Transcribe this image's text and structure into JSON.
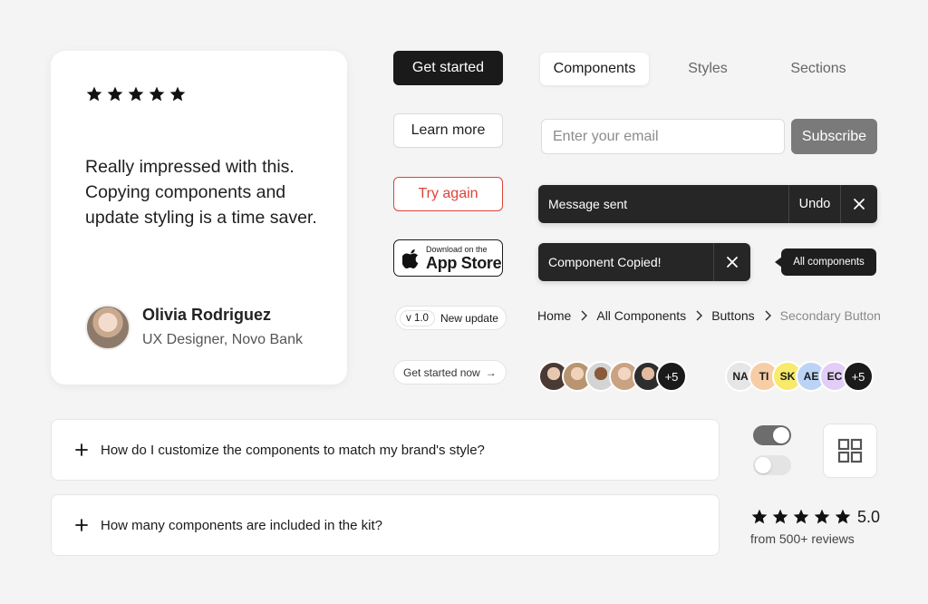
{
  "testimonial": {
    "stars": 5,
    "quote": "Really impressed with this. Copying components and update styling is a time saver.",
    "name": "Olivia Rodriguez",
    "role": "UX Designer, Novo Bank"
  },
  "buttons": {
    "get_started": "Get started",
    "learn_more": "Learn more",
    "try_again": "Try again",
    "app_store_small": "Download on the",
    "app_store_big": "App Store",
    "badge_version": "v 1.0",
    "badge_text": "New update",
    "get_started_now": "Get started now",
    "get_started_now_arrow": "→"
  },
  "tabs": [
    {
      "label": "Components",
      "active": true
    },
    {
      "label": "Styles",
      "active": false
    },
    {
      "label": "Sections",
      "active": false
    }
  ],
  "subscribe": {
    "placeholder": "Enter your email",
    "button": "Subscribe"
  },
  "toasts": {
    "message_sent": "Message sent",
    "undo": "Undo",
    "component_copied": "Component Copied!"
  },
  "tooltip": "All components",
  "breadcrumb": [
    "Home",
    "All Components",
    "Buttons",
    "Secondary Button"
  ],
  "avatar_group_photos": {
    "count_label": "+5"
  },
  "avatar_group_initials": {
    "items": [
      {
        "initials": "NA",
        "color": "#e6e6e6"
      },
      {
        "initials": "TI",
        "color": "#f7cda6"
      },
      {
        "initials": "SK",
        "color": "#f8ea6a"
      },
      {
        "initials": "AE",
        "color": "#bcd3f5"
      },
      {
        "initials": "EC",
        "color": "#e2cdf6"
      }
    ],
    "count_label": "+5"
  },
  "faq": [
    "How do I customize the components to match my brand's style?",
    "How many components are included in the kit?"
  ],
  "toggles": {
    "first": true,
    "second": false
  },
  "rating": {
    "stars": 5,
    "value": "5.0",
    "subtext": "from 500+ reviews"
  },
  "colors": {
    "background": "#f4f4f4",
    "dark": "#1a1a1a",
    "danger": "#e0423a",
    "subscribe_button": "#7a7a7a"
  }
}
